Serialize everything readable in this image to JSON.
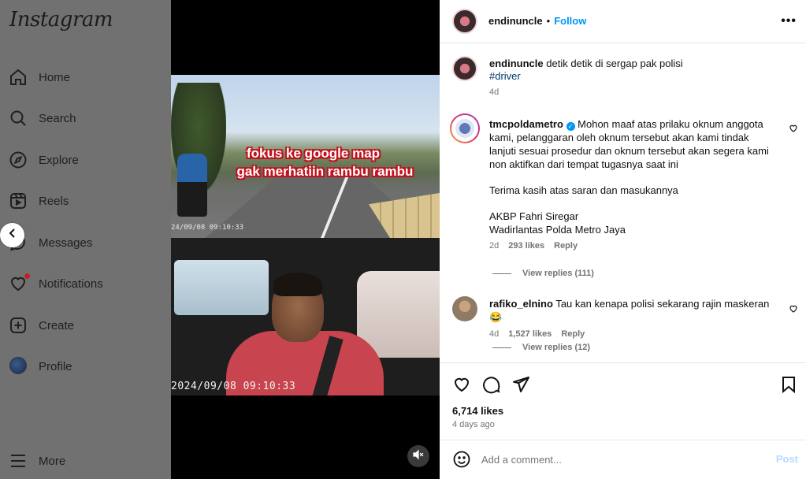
{
  "sidebar": {
    "logo": "Instagram",
    "items": [
      {
        "label": "Home",
        "icon": "home-icon"
      },
      {
        "label": "Search",
        "icon": "search-icon"
      },
      {
        "label": "Explore",
        "icon": "compass-icon"
      },
      {
        "label": "Reels",
        "icon": "reels-icon"
      },
      {
        "label": "Messages",
        "icon": "messenger-icon"
      },
      {
        "label": "Notifications",
        "icon": "heart-icon"
      },
      {
        "label": "Create",
        "icon": "plus-square-icon"
      },
      {
        "label": "Profile",
        "icon": "avatar"
      },
      {
        "label": "More",
        "icon": "hamburger-icon"
      }
    ]
  },
  "video": {
    "caption_line1": "fokus ke google map",
    "caption_line2": "gak merhatiin rambu rambu",
    "timestamp_top": "24/09/08  09:10:33",
    "timestamp_bottom": "2024/09/08  09:10:33"
  },
  "post": {
    "author": "endinuncle",
    "follow_label": "Follow",
    "separator": "•",
    "caption_text": "detik detik di sergap pak polisi",
    "hashtag": "#driver",
    "caption_age": "4d",
    "likes": "6,714 likes",
    "date": "4 days ago"
  },
  "comments": [
    {
      "username": "tmcpoldametro",
      "verified": true,
      "lines": [
        "Mohon maaf atas prilaku oknum anggota",
        "kami, pelanggaran oleh oknum tersebut akan kami tindak",
        "lanjuti sesuai prosedur dan oknum tersebut akan segera kami",
        "non aktifkan dari tempat tugasnya saat ini",
        "Terima kasih atas saran dan masukannya",
        "AKBP Fahri Siregar",
        "Wadirlantas Polda Metro Jaya"
      ],
      "age": "2d",
      "likes": "293 likes",
      "reply_label": "Reply",
      "view_replies": "View replies (111)"
    },
    {
      "username": "rafiko_elnino",
      "text": "Tau kan kenapa polisi sekarang rajin maskeran😂",
      "age": "4d",
      "likes": "1,527 likes",
      "reply_label": "Reply",
      "view_replies": "View replies (12)"
    }
  ],
  "comment_input": {
    "placeholder": "Add a comment...",
    "post_label": "Post"
  },
  "colors": {
    "follow": "#0095f6",
    "hashtag": "#00376b",
    "post_disabled": "#b3dbff",
    "muted_text": "#737373"
  }
}
